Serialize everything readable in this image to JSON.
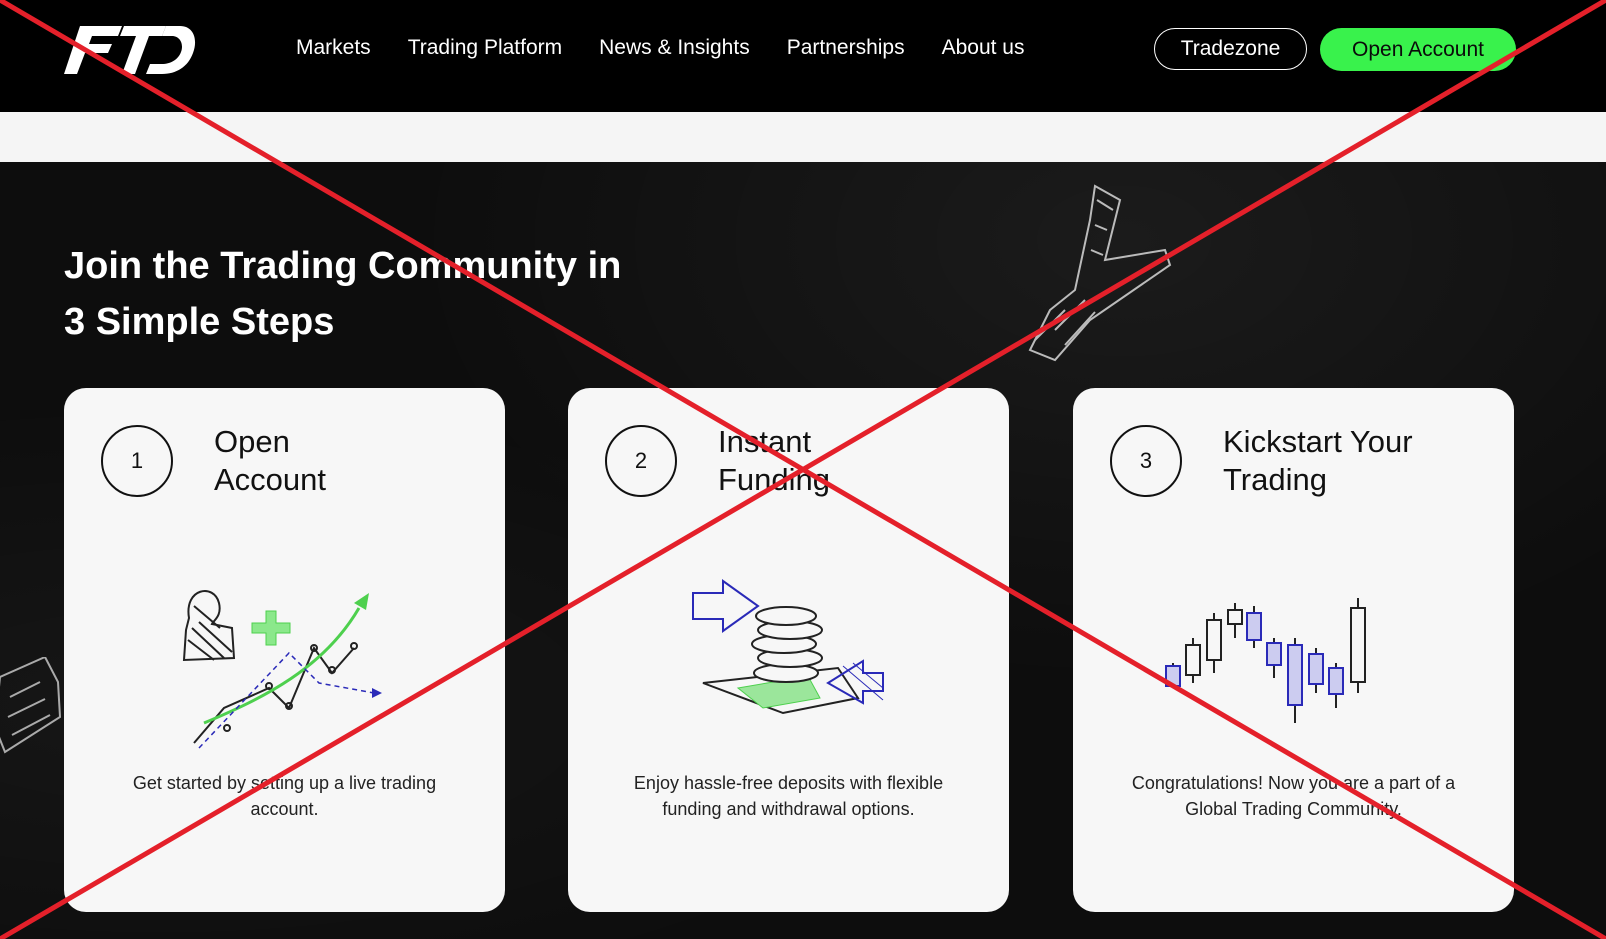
{
  "header": {
    "logo_alt": "FTD",
    "nav": [
      "Markets",
      "Trading Platform",
      "News & Insights",
      "Partnerships",
      "About us"
    ],
    "tradezone_label": "Tradezone",
    "open_account_label": "Open Account"
  },
  "section": {
    "heading_line1": "Join the Trading Community in",
    "heading_line2": "3 Simple Steps",
    "steps": [
      {
        "number": "1",
        "title_line1": "Open",
        "title_line2": "Account",
        "description": "Get started by setting up a live trading account."
      },
      {
        "number": "2",
        "title_line1": "Instant",
        "title_line2": "Funding",
        "description": "Enjoy hassle-free deposits with flexible funding and withdrawal options."
      },
      {
        "number": "3",
        "title_line1": "Kickstart Your",
        "title_line2": "Trading",
        "description": "Congratulations! Now you are a part of a Global Trading Community."
      }
    ]
  },
  "colors": {
    "accent_green": "#39f24c",
    "overlay_red": "#e4202a",
    "sketch_blue": "#2a2ab8"
  }
}
